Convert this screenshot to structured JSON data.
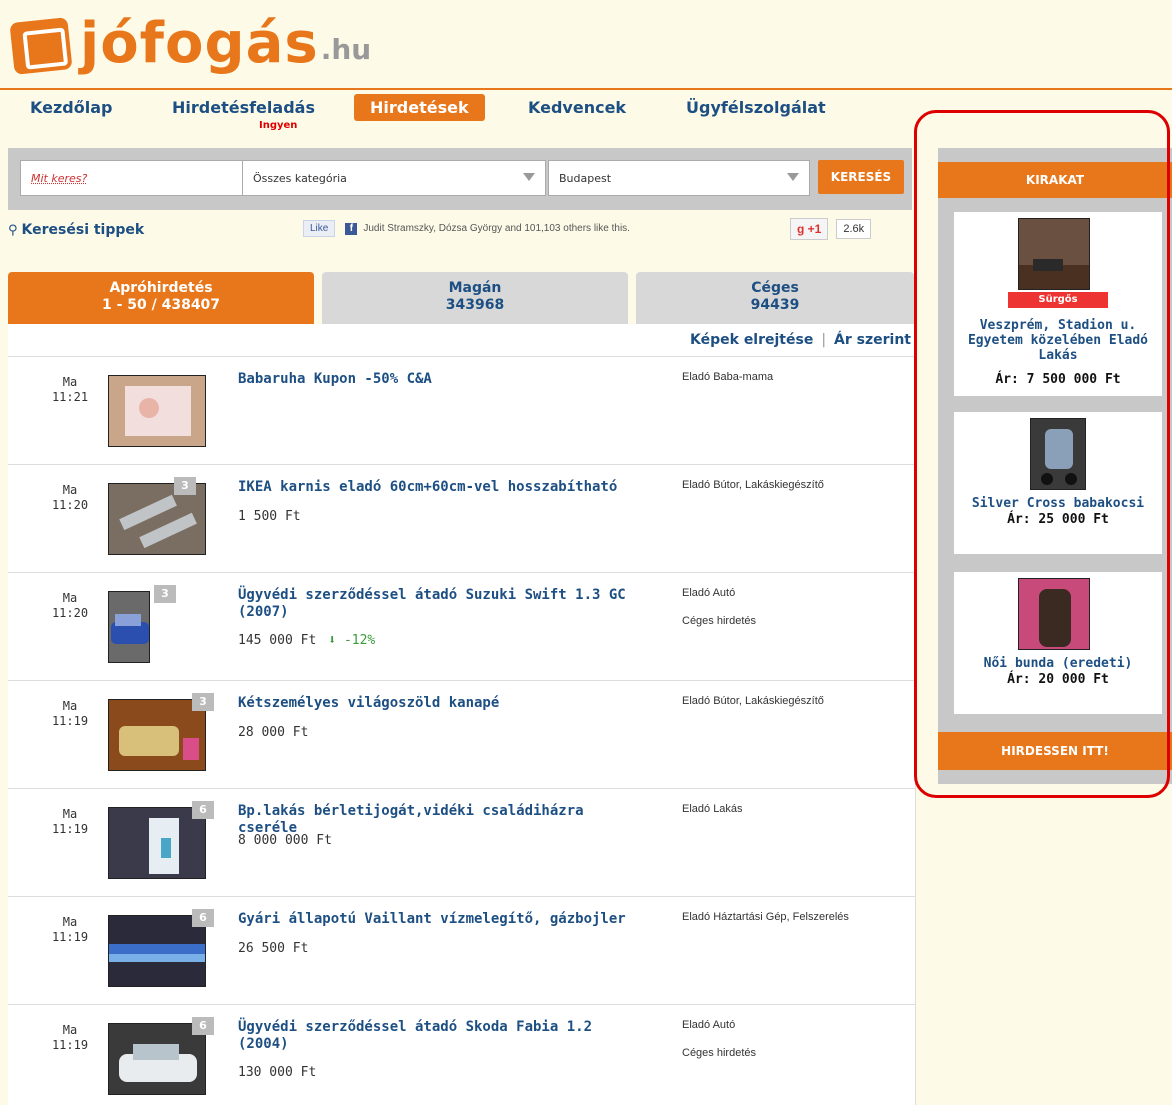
{
  "logo": {
    "text": "jófogás",
    "suffix": ".hu"
  },
  "nav": {
    "items": [
      {
        "label": "Kezdőlap"
      },
      {
        "label": "Hirdetésfeladás"
      },
      {
        "label": "Hirdetések"
      },
      {
        "label": "Kedvencek"
      },
      {
        "label": "Ügyfélszolgálat"
      }
    ],
    "sub_label": "Ingyen"
  },
  "search": {
    "placeholder": "Mit keres?",
    "category": "Összes kategória",
    "location": "Budapest",
    "button": "KERESÉS"
  },
  "tips": {
    "label": "Keresési tippek"
  },
  "facebook": {
    "like": "Like",
    "text": "Judit Stramszky, Dózsa György and 101,103 others like this."
  },
  "gplus": {
    "label": "+1",
    "count": "2.6k"
  },
  "tabs": [
    {
      "label": "Apróhirdetés",
      "sub": "1 - 50 / 438407"
    },
    {
      "label": "Magán",
      "sub": "343968"
    },
    {
      "label": "Céges",
      "sub": "94439"
    }
  ],
  "list_header": {
    "hide_images": "Képek elrejtése",
    "sort": "Ár szerint"
  },
  "listings": [
    {
      "day": "Ma",
      "time": "11:21",
      "title": "Babaruha Kupon -50% C&A",
      "price": "",
      "change": "",
      "category": "Eladó Baba-mama",
      "extra": "",
      "badge": ""
    },
    {
      "day": "Ma",
      "time": "11:20",
      "title": "IKEA karnis eladó 60cm+60cm-vel hosszabítható",
      "price": "1 500 Ft",
      "change": "",
      "category": "Eladó Bútor, Lakáskiegészítő",
      "extra": "",
      "badge": "3"
    },
    {
      "day": "Ma",
      "time": "11:20",
      "title": "Ügyvédi szerződéssel átadó Suzuki Swift 1.3 GC (2007)",
      "price": "145 000 Ft",
      "change": "-12%",
      "category": "Eladó Autó",
      "extra": "Céges hirdetés",
      "badge": "3"
    },
    {
      "day": "Ma",
      "time": "11:19",
      "title": "Kétszemélyes világoszöld kanapé",
      "price": "28 000 Ft",
      "change": "",
      "category": "Eladó Bútor, Lakáskiegészítő",
      "extra": "",
      "badge": "3"
    },
    {
      "day": "Ma",
      "time": "11:19",
      "title": "Bp.lakás bérletijogát,vidéki családiházra cseréle",
      "price": "8 000 000 Ft",
      "change": "",
      "category": "Eladó Lakás",
      "extra": "",
      "badge": "6"
    },
    {
      "day": "Ma",
      "time": "11:19",
      "title": "Gyári állapotú Vaillant vízmelegítő, gázbojler",
      "price": "26 500 Ft",
      "change": "",
      "category": "Eladó Háztartási Gép, Felszerelés",
      "extra": "",
      "badge": "6"
    },
    {
      "day": "Ma",
      "time": "11:19",
      "title": "Ügyvédi szerződéssel átadó Skoda Fabia 1.2 (2004)",
      "price": "130 000 Ft",
      "change": "",
      "category": "Eladó Autó",
      "extra": "Céges hirdetés",
      "badge": "6"
    }
  ],
  "kirakat": {
    "title": "KIRAKAT",
    "footer": "HIRDESSEN ITT!",
    "cards": [
      {
        "title": "Veszprém, Stadion u. Egyetem közelében Eladó Lakás",
        "price": "Ár: 7 500 000 Ft",
        "urgent": "Sürgős"
      },
      {
        "title": "Silver Cross babakocsi",
        "price": "Ár: 25 000 Ft",
        "urgent": ""
      },
      {
        "title": "Női bunda (eredeti)",
        "price": "Ár: 20 000 Ft",
        "urgent": ""
      }
    ]
  },
  "colors": {
    "accent": "#e8761a",
    "link": "#1d4f83",
    "highlight": "#dd0000"
  }
}
